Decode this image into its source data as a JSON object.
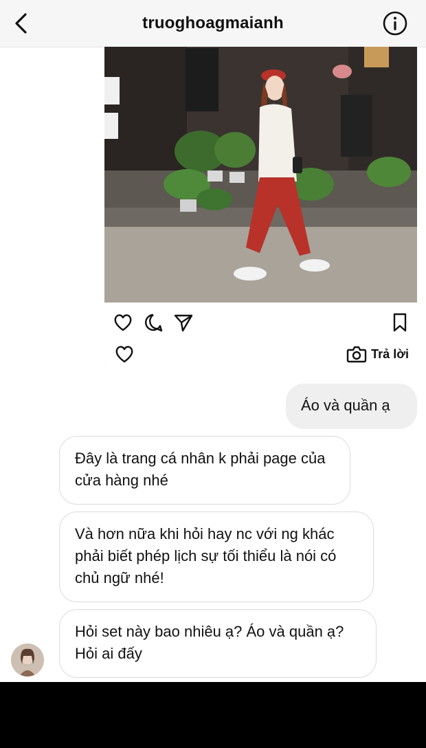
{
  "header": {
    "username": "truoghoagmaianh",
    "back_icon": "chevron-left-icon",
    "info_icon": "info-circle-icon"
  },
  "shared_post": {
    "image_description_icon": "photo",
    "actions": [
      "heart-icon",
      "comment-icon",
      "send-icon",
      "bookmark-icon"
    ],
    "reply_label": "Trả lời"
  },
  "messages": [
    {
      "side": "outgoing",
      "text": "Áo và quần ạ"
    },
    {
      "side": "incoming",
      "text": "Đây là trang cá nhân k phải page của cửa hàng nhé"
    },
    {
      "side": "incoming",
      "text": "Và hơn nữa khi hỏi hay nc với ng khác phải biết phép lịch sự tối thiểu là nói có chủ ngữ nhé!"
    },
    {
      "side": "incoming",
      "text": "Hỏi set này bao nhiêu ạ? Áo và quần ạ? Hỏi ai đấy"
    }
  ],
  "colors": {
    "header_bg": "#f6f6f6",
    "bubble_out": "#efefef",
    "bubble_in_border": "#dbdbdb",
    "outfit_red": "#b8322a"
  }
}
